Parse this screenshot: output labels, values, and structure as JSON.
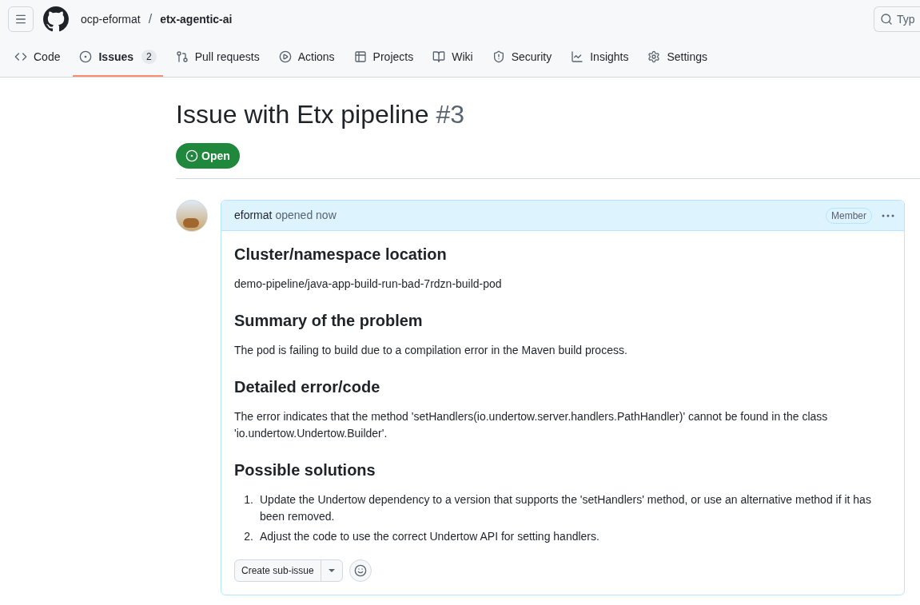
{
  "header": {
    "owner": "ocp-eformat",
    "separator": "/",
    "repo": "etx-agentic-ai",
    "search": {
      "placeholder": "Typ"
    }
  },
  "tabs": [
    {
      "label": "Code",
      "selected": false
    },
    {
      "label": "Issues",
      "count": "2",
      "selected": true
    },
    {
      "label": "Pull requests",
      "selected": false
    },
    {
      "label": "Actions",
      "selected": false
    },
    {
      "label": "Projects",
      "selected": false
    },
    {
      "label": "Wiki",
      "selected": false
    },
    {
      "label": "Security",
      "selected": false
    },
    {
      "label": "Insights",
      "selected": false
    },
    {
      "label": "Settings",
      "selected": false
    }
  ],
  "issue": {
    "title": "Issue with Etx pipeline",
    "number": "#3",
    "state": "Open"
  },
  "comment": {
    "author": "eformat",
    "action": "opened now",
    "badge": "Member",
    "body": [
      {
        "kind": "heading",
        "text": "Cluster/namespace location"
      },
      {
        "kind": "paragraph",
        "text": "demo-pipeline/java-app-build-run-bad-7rdzn-build-pod"
      },
      {
        "kind": "heading",
        "text": "Summary of the problem"
      },
      {
        "kind": "paragraph",
        "text": "The pod is failing to build due to a compilation error in the Maven build process."
      },
      {
        "kind": "heading",
        "text": "Detailed error/code"
      },
      {
        "kind": "paragraph",
        "text": "The error indicates that the method 'setHandlers(io.undertow.server.handlers.PathHandler)' cannot be found in the class 'io.undertow.Undertow.Builder'."
      },
      {
        "kind": "heading",
        "text": "Possible solutions"
      },
      {
        "kind": "list",
        "items": [
          {
            "number": "1.",
            "text": "Update the Undertow dependency to a version that supports the 'setHandlers' method, or use an alternative method if it has been removed."
          },
          {
            "number": "2.",
            "text": "Adjust the code to use the correct Undertow API for setting handlers."
          }
        ]
      }
    ],
    "actions": {
      "sub_issue": "Create sub-issue"
    }
  }
}
